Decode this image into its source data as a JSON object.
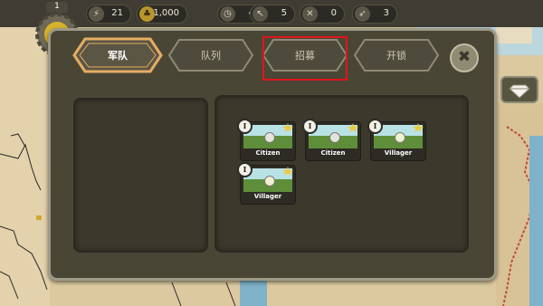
{
  "resources": {
    "level": "1",
    "items": [
      {
        "icon": "lightning-icon",
        "value": "21"
      },
      {
        "icon": "coin-icon",
        "value": "1,000"
      },
      {
        "icon": "timer-icon",
        "value": "4"
      },
      {
        "icon": "axe-icon",
        "value": "5"
      },
      {
        "icon": "crossed-swords-icon",
        "value": "0"
      },
      {
        "icon": "arrow-icon",
        "value": "3"
      }
    ]
  },
  "tabs": [
    {
      "label": "军队",
      "active": true
    },
    {
      "label": "队列",
      "active": false
    },
    {
      "label": "招募",
      "active": false
    },
    {
      "label": "开锁",
      "active": false
    }
  ],
  "close_icon": "close-icon",
  "side_icon": "diamond-icon",
  "units": [
    {
      "name": "Citizen",
      "level": "I",
      "icon": "citizen-icon"
    },
    {
      "name": "Citizen",
      "level": "I",
      "icon": "citizen-icon"
    },
    {
      "name": "Villager",
      "level": "I",
      "icon": "villager-icon"
    },
    {
      "name": "Villager",
      "level": "I",
      "icon": "villager-icon"
    }
  ],
  "colors": {
    "highlight": "#e0141a",
    "active_tab_border": "#e6ad63"
  }
}
